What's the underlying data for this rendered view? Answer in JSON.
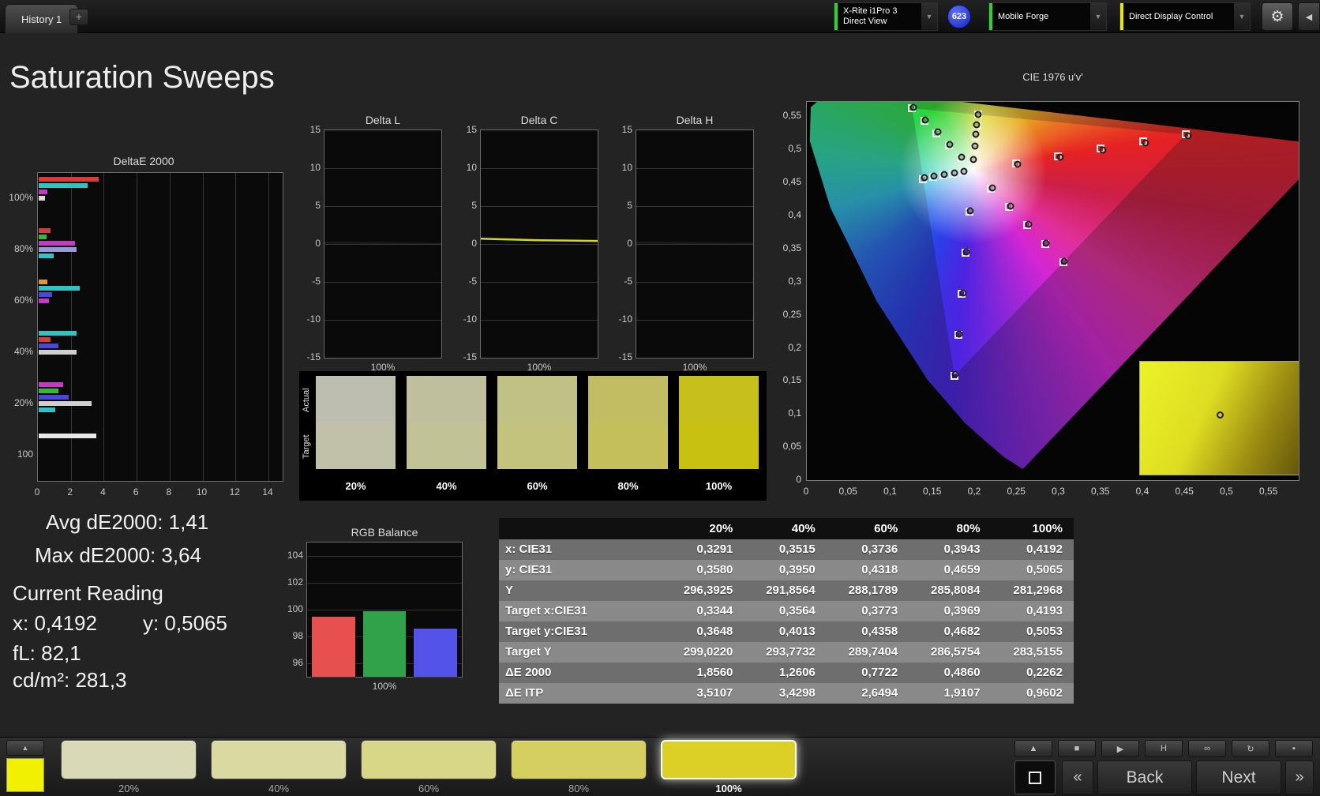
{
  "top_bar": {
    "history_tab": "History 1",
    "add_tab": "+",
    "chevron": "▼",
    "gear_icon": "⚙",
    "collapse_icon": "◀",
    "meter": {
      "line1": "X-Rite i1Pro 3",
      "line2": "Direct View",
      "status_color": "#2fd32f"
    },
    "badge_count": "623",
    "source": {
      "label": "Mobile Forge",
      "status_color": "#2fd32f"
    },
    "display_control": {
      "label": "Direct Display Control",
      "status_color": "#e8e800"
    }
  },
  "page_title": "Saturation Sweeps",
  "stats": {
    "avg_label": "Avg dE2000: 1,41",
    "max_label": "Max dE2000: 3,64",
    "current_reading_title": "Current Reading",
    "x_value": "x: 0,4192",
    "y_value": "y: 0,5065",
    "fl_value": "fL: 82,1",
    "cdm2_value": "cd/m²: 281,3"
  },
  "swatch_strip": {
    "actual_label": "Actual",
    "target_label": "Target",
    "items": [
      {
        "label": "20%",
        "actual": "#bdbdb0",
        "target": "#c1c1a9"
      },
      {
        "label": "40%",
        "actual": "#bfbf9d",
        "target": "#c2c297"
      },
      {
        "label": "60%",
        "actual": "#c1c186",
        "target": "#c3c37e"
      },
      {
        "label": "80%",
        "actual": "#c2bd63",
        "target": "#c4bf5b"
      },
      {
        "label": "100%",
        "actual": "#c6bf1c",
        "target": "#c8c112"
      }
    ]
  },
  "table": {
    "header": [
      "",
      "20%",
      "40%",
      "60%",
      "80%",
      "100%"
    ],
    "rows": [
      {
        "label": "x: CIE31",
        "values": [
          "0,3291",
          "0,3515",
          "0,3736",
          "0,3943",
          "0,4192"
        ]
      },
      {
        "label": "y: CIE31",
        "values": [
          "0,3580",
          "0,3950",
          "0,4318",
          "0,4659",
          "0,5065"
        ]
      },
      {
        "label": "Y",
        "values": [
          "296,3925",
          "291,8564",
          "288,1789",
          "285,8084",
          "281,2968"
        ]
      },
      {
        "label": "Target x:CIE31",
        "values": [
          "0,3344",
          "0,3564",
          "0,3773",
          "0,3969",
          "0,4193"
        ]
      },
      {
        "label": "Target y:CIE31",
        "values": [
          "0,3648",
          "0,4013",
          "0,4358",
          "0,4682",
          "0,5053"
        ]
      },
      {
        "label": "Target Y",
        "values": [
          "299,0220",
          "293,7732",
          "289,7404",
          "286,5754",
          "283,5155"
        ]
      },
      {
        "label": "ΔE 2000",
        "values": [
          "1,8560",
          "1,2606",
          "0,7722",
          "0,4860",
          "0,2262"
        ]
      },
      {
        "label": "ΔE ITP",
        "values": [
          "3,5107",
          "3,4298",
          "2,6494",
          "1,9107",
          "0,9602"
        ]
      }
    ]
  },
  "bottom_bar": {
    "patch_up_icon": "▲",
    "patch_color": "#f0f000",
    "samples": [
      {
        "label": "20%",
        "color": "#d9d9b8",
        "selected": false
      },
      {
        "label": "40%",
        "color": "#d9d9a1",
        "selected": false
      },
      {
        "label": "60%",
        "color": "#d7d787",
        "selected": false
      },
      {
        "label": "80%",
        "color": "#d4cf60",
        "selected": false
      },
      {
        "label": "100%",
        "color": "#dccf25",
        "selected": true
      }
    ],
    "transport_buttons": [
      {
        "name": "up",
        "icon": "▲"
      },
      {
        "name": "stop",
        "icon": "■"
      },
      {
        "name": "play",
        "icon": "▶"
      },
      {
        "name": "histogram",
        "icon": "H"
      },
      {
        "name": "continuous",
        "icon": "∞"
      },
      {
        "name": "refresh",
        "icon": "↻"
      },
      {
        "name": "extra",
        "icon": "▪"
      }
    ],
    "prev_icon": "«",
    "back_label": "Back",
    "next_label": "Next",
    "next_icon": "»"
  },
  "chart_data": [
    {
      "id": "deltae2000",
      "type": "bar",
      "orientation": "horizontal",
      "title": "DeltaE 2000",
      "xlim": [
        0,
        14
      ],
      "xticks": [
        0,
        2,
        4,
        6,
        8,
        10,
        12,
        14
      ],
      "groups": [
        {
          "label": "100%",
          "bars": [
            {
              "color": "#d93a3a",
              "value": 3.64
            },
            {
              "color": "#30c3c3",
              "value": 2.95
            },
            {
              "color": "#c33ac3",
              "value": 0.55
            },
            {
              "color": "#d8d8d8",
              "value": 0.4
            }
          ]
        },
        {
          "label": "80%",
          "bars": [
            {
              "color": "#d93a3a",
              "value": 0.7
            },
            {
              "color": "#38b838",
              "value": 0.5
            },
            {
              "color": "#c33ac3",
              "value": 2.2
            },
            {
              "color": "#9a9ad8",
              "value": 2.3
            },
            {
              "color": "#30c3c3",
              "value": 0.9
            }
          ]
        },
        {
          "label": "60%",
          "bars": [
            {
              "color": "#d99a3a",
              "value": 0.55
            },
            {
              "color": "#30c3c3",
              "value": 2.5
            },
            {
              "color": "#4848d9",
              "value": 0.8
            },
            {
              "color": "#c33ac3",
              "value": 0.6
            }
          ]
        },
        {
          "label": "40%",
          "bars": [
            {
              "color": "#30c3c3",
              "value": 2.3
            },
            {
              "color": "#d93a3a",
              "value": 0.7
            },
            {
              "color": "#4848d9",
              "value": 1.2
            },
            {
              "color": "#cfcfcf",
              "value": 2.3
            }
          ]
        },
        {
          "label": "20%",
          "bars": [
            {
              "color": "#c33ac3",
              "value": 1.5
            },
            {
              "color": "#38b838",
              "value": 1.2
            },
            {
              "color": "#4848d9",
              "value": 1.8
            },
            {
              "color": "#cfc fcf",
              "value": 3.2
            },
            {
              "color": "#30c3c3",
              "value": 1.0
            }
          ]
        },
        {
          "label": "100",
          "bars": [
            {
              "color": "#e8e8e8",
              "value": 3.5
            }
          ]
        }
      ]
    },
    {
      "id": "delta_l",
      "type": "line",
      "title": "Delta L",
      "ylim": [
        -15,
        15
      ],
      "yticks": [
        15,
        10,
        5,
        0,
        -5,
        -10,
        -15
      ],
      "xlabel": "100%",
      "line_color": "#1c1c1c",
      "values": [
        0.2,
        0.15,
        0.1,
        0.05,
        0.0
      ]
    },
    {
      "id": "delta_c",
      "type": "line",
      "title": "Delta C",
      "ylim": [
        -15,
        15
      ],
      "yticks": [
        15,
        10,
        5,
        0,
        -5,
        -10,
        -15
      ],
      "xlabel": "100%",
      "line_color": "#d6d620",
      "values": [
        0.7,
        0.6,
        0.5,
        0.45,
        0.4
      ]
    },
    {
      "id": "delta_h",
      "type": "line",
      "title": "Delta H",
      "ylim": [
        -15,
        15
      ],
      "yticks": [
        15,
        10,
        5,
        0,
        -5,
        -10,
        -15
      ],
      "xlabel": "100%",
      "line_color": "#1c1c1c",
      "values": [
        0.2,
        0.15,
        0.1,
        0.08,
        0.05
      ]
    },
    {
      "id": "rgb_balance",
      "type": "bar",
      "title": "RGB Balance",
      "ylim": [
        95,
        105
      ],
      "yticks": [
        104,
        102,
        100,
        98,
        96
      ],
      "xlabel": "100%",
      "categories": [
        "Red",
        "Green",
        "Blue"
      ],
      "values": [
        99.5,
        99.9,
        98.6
      ],
      "colors": [
        "#e85050",
        "#2fa24a",
        "#5353ea"
      ]
    },
    {
      "id": "cie",
      "type": "scatter",
      "title": "CIE 1976 u'v'",
      "u_max": 0.585,
      "v_max": 0.572,
      "white_point": [
        0.1978,
        0.4683
      ],
      "tick_values": [
        0,
        0.05,
        0.1,
        0.15,
        0.2,
        0.25,
        0.3,
        0.35,
        0.4,
        0.45,
        0.5,
        0.55
      ],
      "tick_labels": [
        "0",
        "0,05",
        "0,1",
        "0,15",
        "0,2",
        "0,25",
        "0,3",
        "0,35",
        "0,4",
        "0,45",
        "0,5",
        "0,55"
      ],
      "targets": [
        [
          0.2484,
          0.4792
        ],
        [
          0.299,
          0.4901
        ],
        [
          0.3495,
          0.5011
        ],
        [
          0.4001,
          0.512
        ],
        [
          0.4507,
          0.5229
        ],
        [
          0.1832,
          0.4871
        ],
        [
          0.1687,
          0.506
        ],
        [
          0.1541,
          0.5248
        ],
        [
          0.1396,
          0.5437
        ],
        [
          0.125,
          0.5625
        ],
        [
          0.1933,
          0.4062
        ],
        [
          0.1888,
          0.3441
        ],
        [
          0.1844,
          0.282
        ],
        [
          0.1799,
          0.2199
        ],
        [
          0.1754,
          0.1579
        ],
        [
          0.1859,
          0.4657
        ],
        [
          0.174,
          0.4631
        ],
        [
          0.1621,
          0.4606
        ],
        [
          0.1502,
          0.458
        ],
        [
          0.1383,
          0.4554
        ],
        [
          0.2192,
          0.4406
        ],
        [
          0.2407,
          0.4129
        ],
        [
          0.2621,
          0.3852
        ],
        [
          0.2836,
          0.3575
        ],
        [
          0.305,
          0.3298
        ],
        [
          0.199,
          0.4852
        ],
        [
          0.2002,
          0.5021
        ],
        [
          0.2014,
          0.519
        ],
        [
          0.2027,
          0.536
        ],
        [
          0.2039,
          0.5529
        ]
      ],
      "measurements": [
        [
          0.251,
          0.478
        ],
        [
          0.3012,
          0.4888
        ],
        [
          0.352,
          0.4995
        ],
        [
          0.403,
          0.5105
        ],
        [
          0.454,
          0.521
        ],
        [
          0.1845,
          0.489
        ],
        [
          0.17,
          0.5075
        ],
        [
          0.1555,
          0.5262
        ],
        [
          0.141,
          0.545
        ],
        [
          0.1268,
          0.564
        ],
        [
          0.1945,
          0.4075
        ],
        [
          0.19,
          0.3455
        ],
        [
          0.1856,
          0.2835
        ],
        [
          0.1812,
          0.2215
        ],
        [
          0.177,
          0.16
        ],
        [
          0.187,
          0.467
        ],
        [
          0.1752,
          0.4645
        ],
        [
          0.1633,
          0.462
        ],
        [
          0.1514,
          0.4594
        ],
        [
          0.1395,
          0.4568
        ],
        [
          0.2205,
          0.442
        ],
        [
          0.242,
          0.4142
        ],
        [
          0.2634,
          0.3865
        ],
        [
          0.2849,
          0.3588
        ],
        [
          0.3063,
          0.331
        ],
        [
          0.1983,
          0.4854
        ],
        [
          0.1998,
          0.5052
        ],
        [
          0.201,
          0.5227
        ],
        [
          0.2021,
          0.5374
        ],
        [
          0.2035,
          0.5532
        ]
      ]
    }
  ]
}
